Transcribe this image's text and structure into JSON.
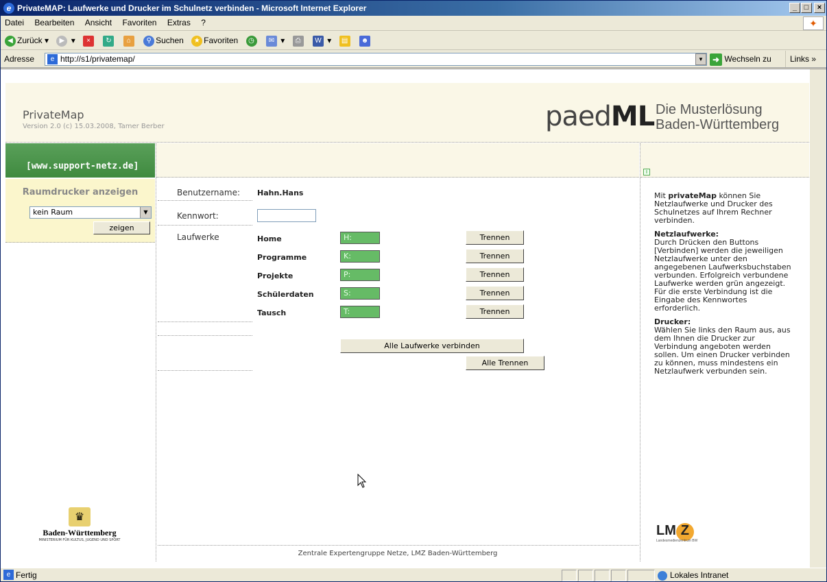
{
  "window": {
    "title": "PrivateMAP: Laufwerke und Drucker im Schulnetz verbinden - Microsoft Internet Explorer",
    "min": "_",
    "max": "□",
    "close": "×"
  },
  "menu": [
    "Datei",
    "Bearbeiten",
    "Ansicht",
    "Favoriten",
    "Extras",
    "?"
  ],
  "toolbar": {
    "back": "Zurück",
    "search": "Suchen",
    "favorites": "Favoriten"
  },
  "address": {
    "label": "Adresse",
    "url": "http://s1/privatemap/",
    "go": "Wechseln zu",
    "links": "Links"
  },
  "header": {
    "app_name": "PrivateMap",
    "version": "Version 2.0 (c) 15.03.2008, Tamer Berber",
    "brand_light": "paed",
    "brand_bold": "ML",
    "tagline1": "Die Musterlösung",
    "tagline2": "Baden-Württemberg"
  },
  "left": {
    "support": "[www.support-netz.de]",
    "raum_title": "Raumdrucker anzeigen",
    "raum_selected": "kein Raum",
    "zeigen": "zeigen",
    "bw_name": "Baden-Württemberg",
    "bw_ministry": "MINISTERIUM FÜR KULTUS, JUGEND UND SPORT"
  },
  "form": {
    "user_label": "Benutzername:",
    "user_value": "Hahn.Hans",
    "pw_label": "Kennwort:",
    "drives_label": "Laufwerke",
    "drives": [
      {
        "name": "Home",
        "letter": "H:",
        "action": "Trennen"
      },
      {
        "name": "Programme",
        "letter": "K:",
        "action": "Trennen"
      },
      {
        "name": "Projekte",
        "letter": "P:",
        "action": "Trennen"
      },
      {
        "name": "Schülerdaten",
        "letter": "S:",
        "action": "Trennen"
      },
      {
        "name": "Tausch",
        "letter": "T:",
        "action": "Trennen"
      }
    ],
    "connect_all": "Alle Laufwerke verbinden",
    "disconnect_all": "Alle Trennen"
  },
  "info": {
    "icon": "i",
    "intro_pre": "Mit ",
    "intro_bold": "privateMap",
    "intro_post": " können Sie Netzlaufwerke und Drucker des Schulnetzes auf Ihrem Rechner verbinden.",
    "net_title": "Netzlaufwerke:",
    "net_text": "Durch Drücken den Buttons [Verbinden] werden die jeweiligen Netzlaufwerke unter den angegebenen Laufwerksbuchstaben verbunden. Erfolgreich verbundene Laufwerke werden grün angezeigt. Für die erste Verbindung ist die Eingabe des Kennwortes erforderlich.",
    "print_title": "Drucker:",
    "print_text": "Wählen Sie links den Raum aus, aus dem Ihnen die Drucker zur Verbindung angeboten werden sollen. Um einen Drucker verbinden zu können, muss mindestens ein Netzlaufwerk verbunden sein."
  },
  "footer": "Zentrale Expertengruppe Netze, LMZ Baden-Württemberg",
  "lmz": {
    "text": "LM",
    "z": "Z",
    "sub": "Landesmedienzentrum BW"
  },
  "status": {
    "text": "Fertig",
    "zone": "Lokales Intranet"
  }
}
